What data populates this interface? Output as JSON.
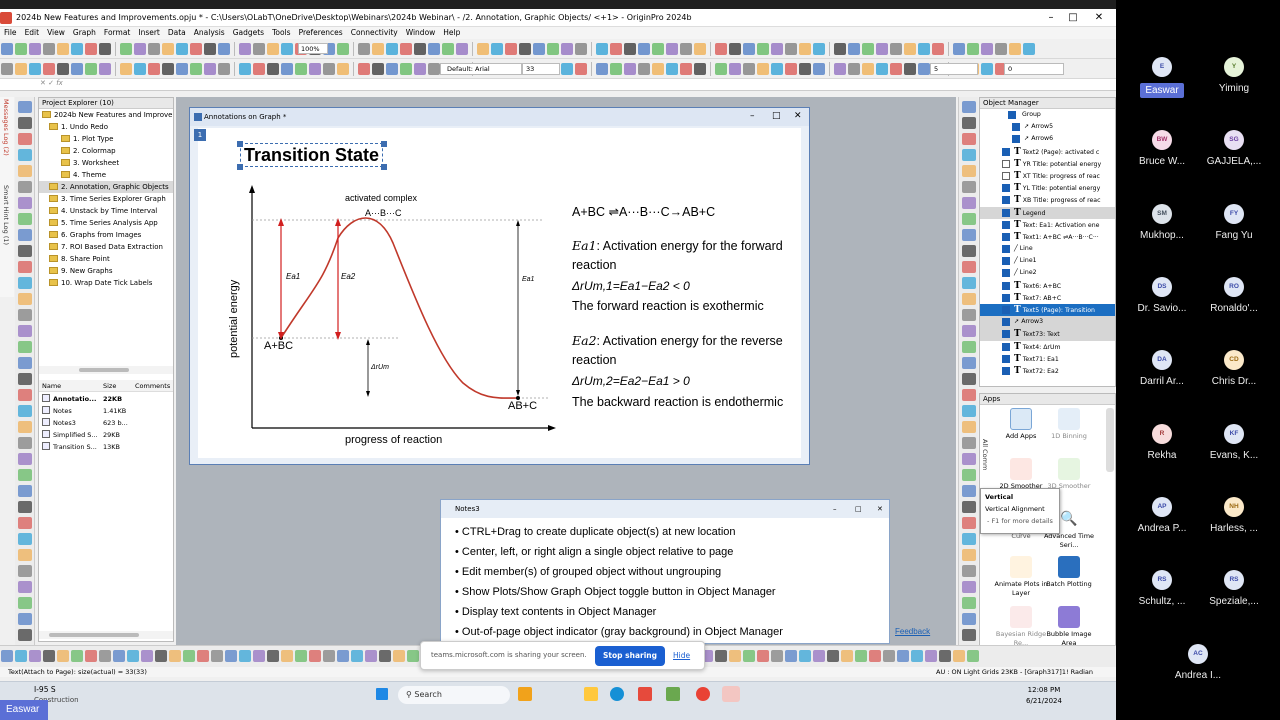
{
  "window": {
    "title": "2024b New Features and Improvements.opju * - C:\\Users\\OLabT\\OneDrive\\Desktop\\Webinars\\2024b Webinar\\ - /2. Annotation, Graphic Objects/ <+1> - OriginPro 2024b"
  },
  "menu": [
    "File",
    "Edit",
    "View",
    "Graph",
    "Format",
    "Insert",
    "Data",
    "Analysis",
    "Gadgets",
    "Tools",
    "Preferences",
    "Connectivity",
    "Window",
    "Help"
  ],
  "toolbar": {
    "zoom": "100%",
    "font": "Default: Arial",
    "font_size": "33",
    "value_zero": "0",
    "value_five": "5"
  },
  "project_explorer": {
    "title": "Project Explorer (10)",
    "root": "2024b New Features and Improver",
    "folders": [
      "1. Undo Redo",
      "1. Plot Type",
      "2. Colormap",
      "3. Worksheet",
      "4. Theme",
      "2. Annotation, Graphic Objects",
      "3. Time Series Explorer Graph",
      "4. Unstack by Time Interval",
      "5. Time Series Analysis App",
      "6. Graphs from Images",
      "7. ROI Based Data Extraction",
      "8. Share Point",
      "9. New Graphs",
      "10. Wrap Date Tick Labels"
    ],
    "columns": [
      "Name",
      "Size",
      "Comments"
    ],
    "files": [
      {
        "name": "Annotatio...",
        "size": "22KB"
      },
      {
        "name": "Notes",
        "size": "1.41KB"
      },
      {
        "name": "Notes3",
        "size": "623 b..."
      },
      {
        "name": "Simplified S...",
        "size": "29KB"
      },
      {
        "name": "Transition S...",
        "size": "13KB"
      }
    ]
  },
  "side_tabs": {
    "messages": "Messages Log (2)",
    "smart_hint": "Smart Hint Log (1)"
  },
  "graph_window": {
    "title": "Annotations on Graph *",
    "layer": "1",
    "heading": "Transition State",
    "xlabel": "progress of reaction",
    "ylabel": "potential energy",
    "label_activated": "activated complex",
    "label_complex": "A···B···C",
    "label_reactants": "A+BC",
    "label_products": "AB+C",
    "label_ea1": "Ea1",
    "label_ea2": "Ea2",
    "label_ea1_right": "Ea1",
    "label_dU": "ΔrUm",
    "eq_reaction": "A+BC ⇌A···B···C→AB+C",
    "ea1_desc_sym": "Ea1",
    "ea1_desc": ": Activation energy for the forward reaction",
    "eq1": "ΔrUm,1=Ea1−Ea2 < 0",
    "forward": "The forward reaction is exothermic",
    "ea2_desc_sym": "Ea2",
    "ea2_desc": ": Activation energy for the reverse reaction",
    "eq2": "ΔrUm,2=Ea2−Ea1 > 0",
    "backward": "The backward reaction is endothermic"
  },
  "notes": {
    "title": "Notes3",
    "items": [
      "CTRL+Drag to create duplicate object(s) at new location",
      "Center, left, or right align a single object relative to page",
      "Edit member(s) of grouped object without ungrouping",
      "Show Plots/Show Graph Object toggle button in Object Manager",
      "Display text contents in Object Manager",
      "Out-of-page object indicator (gray background) in Object Manager"
    ]
  },
  "object_manager": {
    "title": "Object Manager",
    "group": "Group",
    "rows": [
      {
        "label": "Arrow5",
        "icon": "arrow",
        "checked": true
      },
      {
        "label": "Arrow6",
        "icon": "arrow",
        "checked": true
      },
      {
        "label": "Text2 (Page): activated c",
        "icon": "T",
        "checked": true
      },
      {
        "label": "YR Title: potential energy",
        "icon": "T",
        "checked": false
      },
      {
        "label": "XT Title: progress of reac",
        "icon": "T",
        "checked": false
      },
      {
        "label": "YL Title: potential energy",
        "icon": "T",
        "checked": true
      },
      {
        "label": "XB Title: progress of reac",
        "icon": "T",
        "checked": true
      },
      {
        "label": "Legend",
        "icon": "T",
        "checked": true,
        "gray": true
      },
      {
        "label": "Text: Ea1: Activation ene",
        "icon": "T",
        "checked": true
      },
      {
        "label": "Text1: A+BC ⇌A···B···C···",
        "icon": "T",
        "checked": true
      },
      {
        "label": "Line",
        "icon": "line",
        "checked": true
      },
      {
        "label": "Line1",
        "icon": "line",
        "checked": true
      },
      {
        "label": "Line2",
        "icon": "line",
        "checked": true
      },
      {
        "label": "Text6: A+BC",
        "icon": "T",
        "checked": true
      },
      {
        "label": "Text7: AB+C",
        "icon": "T",
        "checked": true
      },
      {
        "label": "Text5 (Page): Transition",
        "icon": "T",
        "checked": true,
        "selected": true
      },
      {
        "label": "Arrow3",
        "icon": "arrow",
        "checked": true,
        "gray": true
      },
      {
        "label": "Text73: Text",
        "icon": "T",
        "checked": true,
        "gray": true
      },
      {
        "label": "Text4: ΔrUm",
        "icon": "T",
        "checked": true
      },
      {
        "label": "Text71: Ea1",
        "icon": "T",
        "checked": true
      },
      {
        "label": "Text72: Ea2",
        "icon": "T",
        "checked": true
      }
    ]
  },
  "apps": {
    "title": "Apps",
    "side_label": "All Comm",
    "items": [
      "Add Apps",
      "1D Binning",
      "2D Smoother",
      "3D Smoother",
      "Curve",
      "Advanced Time Seri...",
      "Animate Plots in Layer",
      "Batch Plotting",
      "Bayesian Ridge Re...",
      "Bubble Image Area"
    ],
    "feedback": "Feedback"
  },
  "tooltip": {
    "title": "Vertical",
    "sub": "Vertical Alignment",
    "hint": "- F1 for more details -"
  },
  "status": {
    "left": "Text(Attach to Page): size(actual) = 33(33)",
    "right": "AU : ON  Light Grids     23KB - [Graph317]1!   Radian"
  },
  "share": {
    "text": "teams.microsoft.com is sharing your screen.",
    "stop": "Stop sharing",
    "hide": "Hide"
  },
  "taskbar": {
    "weather_temp": "I-95 S",
    "weather_desc": "Construction",
    "search": "Search",
    "time": "12:08 PM",
    "date": "6/21/2024"
  },
  "participants": [
    {
      "initials": "E",
      "name": "Easwar",
      "bg": "#dfe6f5",
      "fg": "#3b4aa8",
      "highlight": true
    },
    {
      "initials": "Y",
      "name": "Yiming",
      "bg": "#e6f3d9",
      "fg": "#557a2a"
    },
    {
      "initials": "BW",
      "name": "Bruce W...",
      "bg": "#f6dbe8",
      "fg": "#a4336b"
    },
    {
      "initials": "SG",
      "name": "GAJJELA,...",
      "bg": "#e8dff3",
      "fg": "#6a3ea0"
    },
    {
      "initials": "SM",
      "name": "Mukhop...",
      "bg": "#dde3ea",
      "fg": "#44505e"
    },
    {
      "initials": "FY",
      "name": "Fang Yu",
      "bg": "#dfe6f5",
      "fg": "#3b4aa8"
    },
    {
      "initials": "DS",
      "name": "Dr. Savio...",
      "bg": "#dfe6f5",
      "fg": "#3b4aa8"
    },
    {
      "initials": "RO",
      "name": "Ronaldo'...",
      "bg": "#dfe6f5",
      "fg": "#3b4aa8"
    },
    {
      "initials": "DA",
      "name": "Darril Ar...",
      "bg": "#dfe6f5",
      "fg": "#3b4aa8"
    },
    {
      "initials": "CD",
      "name": "Chris Dr...",
      "bg": "#fbe9c9",
      "fg": "#9c6a12"
    },
    {
      "initials": "R",
      "name": "Rekha",
      "bg": "#f7dcdc",
      "fg": "#a33b3b"
    },
    {
      "initials": "KF",
      "name": "Evans, K...",
      "bg": "#dfe6f5",
      "fg": "#3b4aa8"
    },
    {
      "initials": "AP",
      "name": "Andrea P...",
      "bg": "#dfe6f5",
      "fg": "#3b4aa8"
    },
    {
      "initials": "NH",
      "name": "Harless, ...",
      "bg": "#fbe9c9",
      "fg": "#9c6a12"
    },
    {
      "initials": "RS",
      "name": "Schultz, ...",
      "bg": "#dfe6f5",
      "fg": "#3b4aa8"
    },
    {
      "initials": "RS",
      "name": "Speziale,...",
      "bg": "#dfe6f5",
      "fg": "#3b4aa8"
    },
    {
      "initials": "AC",
      "name": "Andrea I...",
      "bg": "#dfe6f5",
      "fg": "#3b4aa8"
    }
  ],
  "presenter_tag": "Easwar",
  "colors": {
    "curve": "#c0392b",
    "accent": "#1b6ec2",
    "arrow": "#d21f1f"
  }
}
